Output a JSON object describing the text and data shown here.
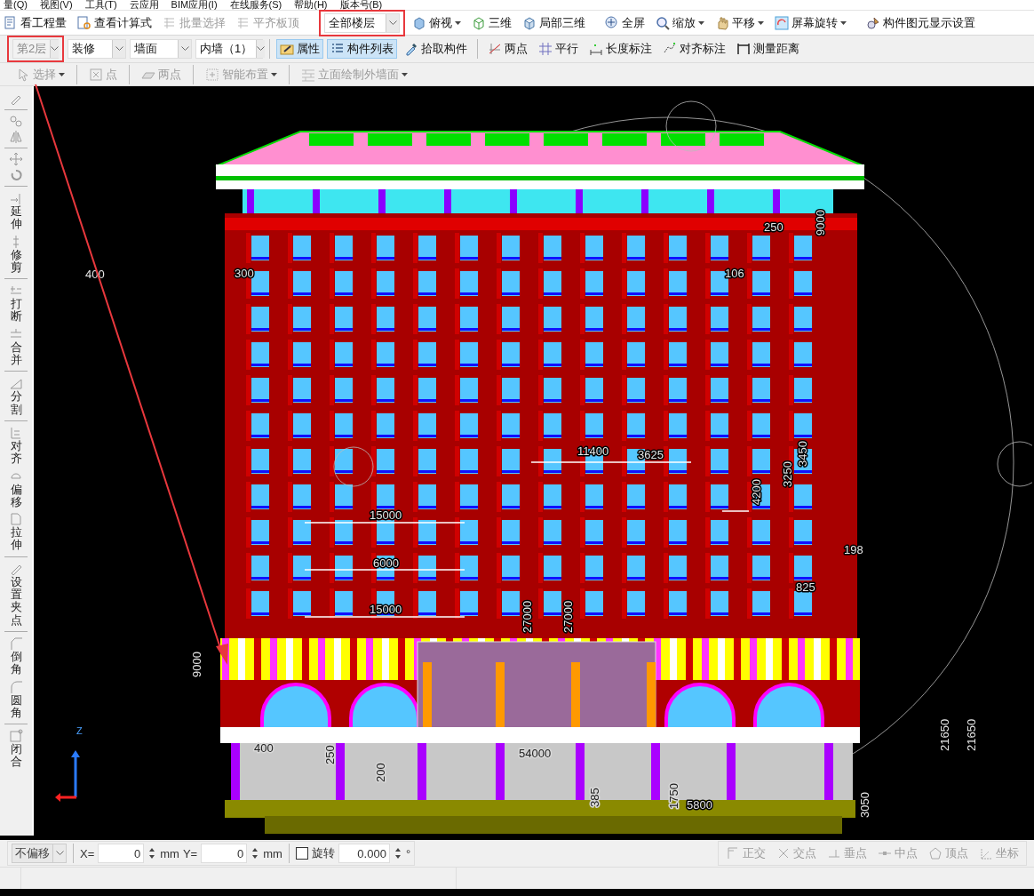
{
  "menu_bar": {
    "items": [
      "量(Q)",
      "视图(V)",
      "工具(T)",
      "云应用",
      "BIM应用(I)",
      "在线服务(S)",
      "帮助(H)",
      "版本号(B)"
    ]
  },
  "main_toolbar": {
    "items": [
      {
        "kind": "button",
        "label": "看工程量",
        "disabled": false,
        "dropdown": false
      },
      {
        "kind": "button",
        "label": "查看计算式",
        "disabled": false,
        "dropdown": false
      },
      {
        "kind": "button",
        "label": "批量选择",
        "disabled": true,
        "dropdown": false
      },
      {
        "kind": "button",
        "label": "平齐板顶",
        "disabled": true,
        "dropdown": false
      },
      {
        "kind": "select",
        "value": "全部楼层",
        "disabled": false,
        "highlighted": true
      },
      {
        "kind": "button",
        "label": "俯视",
        "disabled": false,
        "dropdown": true
      },
      {
        "kind": "button",
        "label": "三维",
        "disabled": false,
        "dropdown": false
      },
      {
        "kind": "button",
        "label": "局部三维",
        "disabled": false,
        "dropdown": false
      },
      {
        "kind": "button",
        "label": "全屏",
        "disabled": false,
        "dropdown": false
      },
      {
        "kind": "button",
        "label": "缩放",
        "disabled": false,
        "dropdown": true
      },
      {
        "kind": "button",
        "label": "平移",
        "disabled": false,
        "dropdown": true
      },
      {
        "kind": "button",
        "label": "屏幕旋转",
        "disabled": false,
        "dropdown": true
      },
      {
        "kind": "button",
        "label": "构件图元显示设置",
        "disabled": false,
        "dropdown": false
      }
    ]
  },
  "draw_toolbar": {
    "items": [
      {
        "kind": "select",
        "value": "第2层",
        "disabled": true,
        "highlighted": true
      },
      {
        "kind": "select",
        "value": "装修",
        "disabled": false,
        "highlighted": false
      },
      {
        "kind": "select",
        "value": "墙面",
        "disabled": false,
        "highlighted": false
      },
      {
        "kind": "select",
        "value": "内墙（1）",
        "disabled": false,
        "highlighted": false
      },
      {
        "kind": "toggle",
        "label": "属性",
        "selected": true
      },
      {
        "kind": "toggle",
        "label": "构件列表",
        "selected": true
      },
      {
        "kind": "button",
        "label": "拾取构件",
        "disabled": false,
        "dropdown": false
      },
      {
        "kind": "button",
        "label": "两点",
        "disabled": false,
        "dropdown": false
      },
      {
        "kind": "button",
        "label": "平行",
        "disabled": false,
        "dropdown": false
      },
      {
        "kind": "button",
        "label": "长度标注",
        "disabled": false,
        "dropdown": false
      },
      {
        "kind": "button",
        "label": "对齐标注",
        "disabled": false,
        "dropdown": false
      },
      {
        "kind": "button",
        "label": "测量距离",
        "disabled": false,
        "dropdown": false
      }
    ]
  },
  "mode_toolbar": {
    "items": [
      {
        "label": "选择",
        "disabled": true,
        "dropdown": true
      },
      {
        "label": "点",
        "disabled": true,
        "dropdown": false
      },
      {
        "label": "两点",
        "disabled": true,
        "dropdown": false
      },
      {
        "label": "智能布置",
        "disabled": true,
        "dropdown": true
      },
      {
        "label": "立面绘制外墙面",
        "disabled": true,
        "dropdown": true
      }
    ]
  },
  "edit_toolbar": {
    "items": [
      {
        "label": "延伸",
        "disabled": false
      },
      {
        "label": "修剪",
        "disabled": false
      },
      {
        "label": "打断",
        "disabled": false
      },
      {
        "label": "合并",
        "disabled": false
      },
      {
        "label": "分割",
        "disabled": false
      },
      {
        "label": "对齐",
        "disabled": false
      },
      {
        "label": "偏移",
        "disabled": false
      },
      {
        "label": "拉伸",
        "disabled": false
      },
      {
        "label": "设置夹点",
        "disabled": false
      },
      {
        "label": "倒角",
        "disabled": false
      },
      {
        "label": "圆角",
        "disabled": false
      },
      {
        "label": "闭合",
        "disabled": false
      }
    ]
  },
  "canvas": {
    "dimension_labels": [
      "400",
      "300",
      "250",
      "106",
      "11400",
      "3625",
      "15000",
      "6000",
      "15000",
      "198",
      "825",
      "54000",
      "400",
      "5800",
      "9000",
      "9000",
      "4200",
      "3450",
      "3250",
      "27000",
      "27000",
      "200",
      "250",
      "385",
      "1750",
      "21650",
      "21650",
      "3050"
    ],
    "axis_labels": [
      "Z"
    ]
  },
  "coordinate_bar": {
    "offset_mode": "不偏移",
    "x_label": "X=",
    "x_value": "0",
    "x_unit": "mm",
    "y_label": "Y=",
    "y_value": "0",
    "y_unit": "mm",
    "rotate_label": "旋转",
    "rotate_checked": false,
    "angle_value": "0.000",
    "angle_unit": "°"
  },
  "snap_toolbar": {
    "items": [
      {
        "label": "正交",
        "disabled": true
      },
      {
        "label": "交点",
        "disabled": true
      },
      {
        "label": "垂点",
        "disabled": true
      },
      {
        "label": "中点",
        "disabled": true
      },
      {
        "label": "顶点",
        "disabled": true
      },
      {
        "label": "坐标",
        "disabled": true
      }
    ]
  }
}
